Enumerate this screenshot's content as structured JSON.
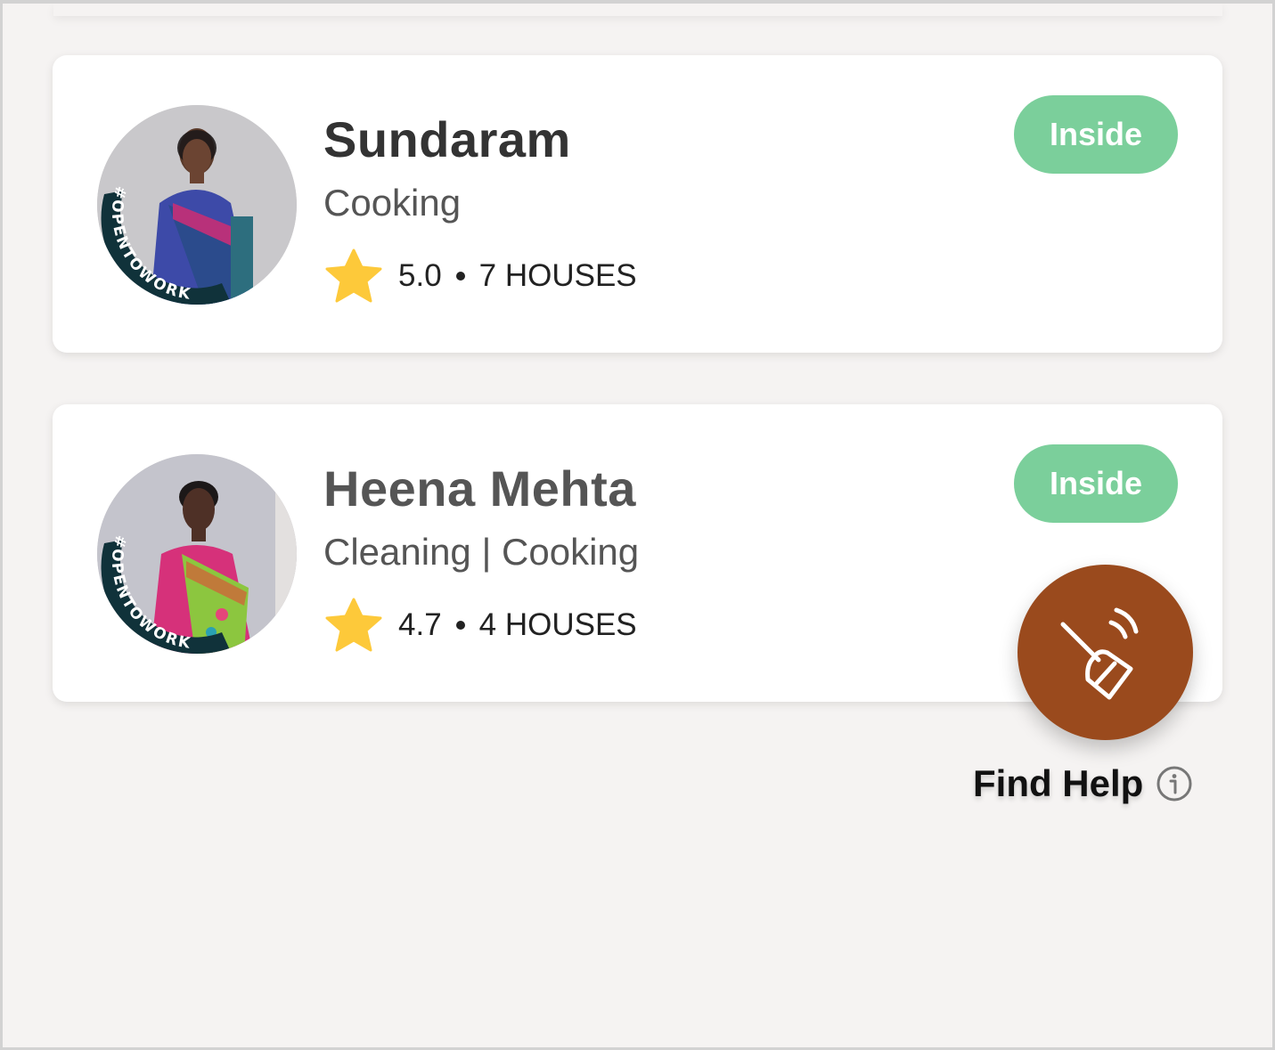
{
  "workers": [
    {
      "name": "Sundaram",
      "skills": "Cooking",
      "rating": "5.0",
      "separator": "•",
      "houses": "7 HOUSES",
      "status": "Inside",
      "badge_text": "#OPENTOWORK"
    },
    {
      "name": "Heena Mehta",
      "skills": "Cleaning | Cooking",
      "rating": "4.7",
      "separator": "•",
      "houses": "4 HOUSES",
      "status": "Inside",
      "badge_text": "#OPENTOWORK"
    }
  ],
  "fab": {
    "label": "Find Help",
    "icon": "broom-icon",
    "info_icon": "info-icon"
  },
  "colors": {
    "status_pill": "#7bcf9b",
    "fab": "#9a4a1d",
    "star": "#fdc93a",
    "badge_ring": "#10323a"
  }
}
